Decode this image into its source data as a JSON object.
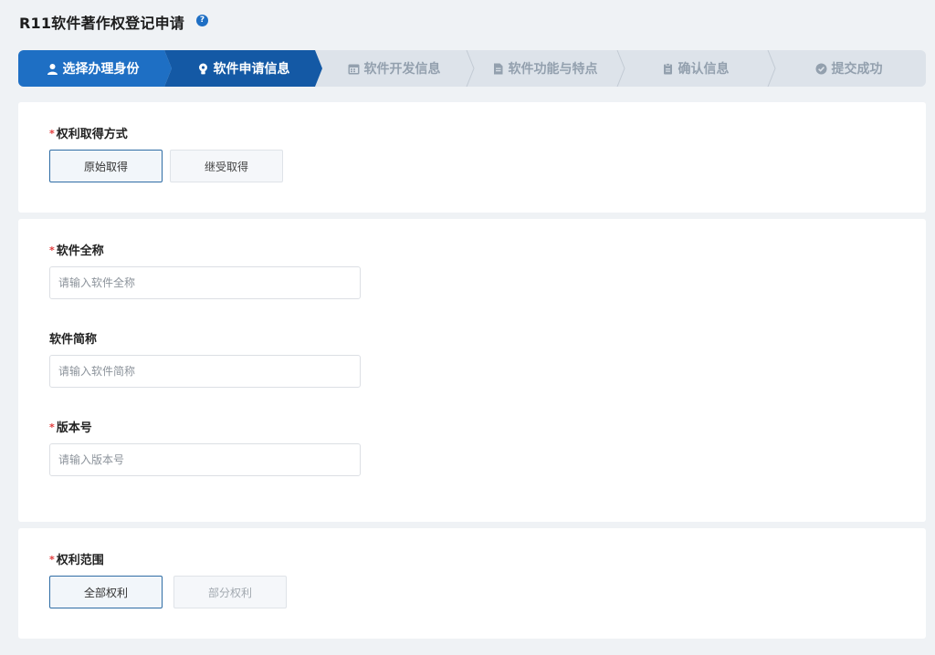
{
  "header": {
    "title": "R11软件著作权登记申请",
    "help_icon": "question-circle-icon",
    "help_glyph": "?"
  },
  "colors": {
    "step_done": "#1e6fc4",
    "step_active": "#1459a5",
    "step_pending": "#dde3ea",
    "accent": "#2f6da5",
    "required": "#e23b3b"
  },
  "steps": [
    {
      "label": "选择办理身份",
      "icon": "user-icon",
      "state": "done"
    },
    {
      "label": "软件申请信息",
      "icon": "lightbulb-icon",
      "state": "active"
    },
    {
      "label": "软件开发信息",
      "icon": "calendar-icon",
      "state": "pending"
    },
    {
      "label": "软件功能与特点",
      "icon": "document-icon",
      "state": "pending"
    },
    {
      "label": "确认信息",
      "icon": "clipboard-icon",
      "state": "pending"
    },
    {
      "label": "提交成功",
      "icon": "check-circle-icon",
      "state": "pending"
    }
  ],
  "form": {
    "required_mark": "*",
    "acquisition": {
      "label": "权利取得方式",
      "options": [
        "原始取得",
        "继受取得"
      ],
      "selected": "原始取得"
    },
    "full_name": {
      "label": "软件全称",
      "placeholder": "请输入软件全称",
      "value": ""
    },
    "short_name": {
      "label": "软件简称",
      "placeholder": "请输入软件简称",
      "value": ""
    },
    "version": {
      "label": "版本号",
      "placeholder": "请输入版本号",
      "value": ""
    },
    "scope": {
      "label": "权利范围",
      "options": [
        "全部权利",
        "部分权利"
      ],
      "selected": "全部权利"
    }
  }
}
